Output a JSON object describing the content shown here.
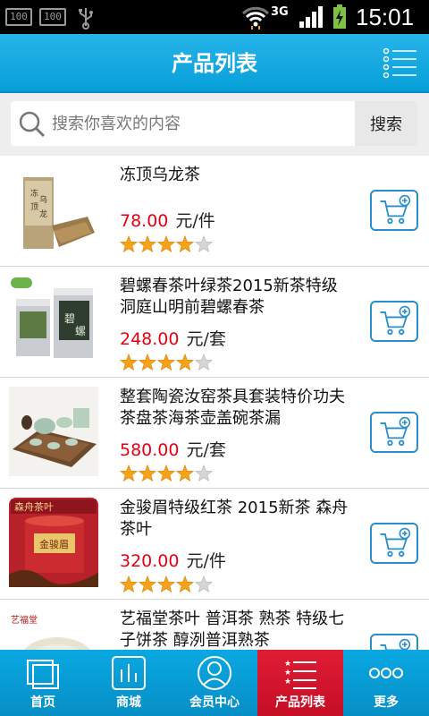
{
  "status_bar": {
    "notif_1": "100",
    "notif_2": "100",
    "network": "3G",
    "time": "15:01",
    "icons": [
      "notification-icon",
      "notification-icon",
      "usb-icon",
      "wifi-icon",
      "signal-icon",
      "battery-charging-icon"
    ]
  },
  "header": {
    "title": "产品列表",
    "menu_icon": "list-menu-icon"
  },
  "search": {
    "placeholder": "搜索你喜欢的内容",
    "value": "",
    "button_label": "搜索"
  },
  "products": [
    {
      "name": "冻顶乌龙茶",
      "price": "78.00",
      "unit": "元/件",
      "rating": 4,
      "max_rating": 5
    },
    {
      "name": "碧螺春茶叶绿茶2015新茶特级洞庭山明前碧螺春茶",
      "price": "248.00",
      "unit": "元/套",
      "rating": 4,
      "max_rating": 5
    },
    {
      "name": "整套陶瓷汝窑茶具套装特价功夫茶盘茶海茶壶盖碗茶漏",
      "price": "580.00",
      "unit": "元/套",
      "rating": 4,
      "max_rating": 5
    },
    {
      "name": "金骏眉特级红茶 2015新茶 森舟茶叶",
      "price": "320.00",
      "unit": "元/件",
      "rating": 4,
      "max_rating": 5
    },
    {
      "name": "艺福堂茶叶 普洱茶 熟茶 特级七子饼茶 醇洌普洱熟茶",
      "price": "",
      "unit": "",
      "rating": 0,
      "max_rating": 5
    }
  ],
  "bottom_nav": [
    {
      "label": "首页",
      "icon": "home-icon",
      "active": false
    },
    {
      "label": "商城",
      "icon": "mall-chart-icon",
      "active": false
    },
    {
      "label": "会员中心",
      "icon": "member-icon",
      "active": false
    },
    {
      "label": "产品列表",
      "icon": "product-list-icon",
      "active": true
    },
    {
      "label": "更多",
      "icon": "more-icon",
      "active": false
    }
  ],
  "colors": {
    "header": "#0aa6df",
    "price": "#e60012",
    "nav_active": "#d2162c",
    "star": "#f7a21b"
  }
}
